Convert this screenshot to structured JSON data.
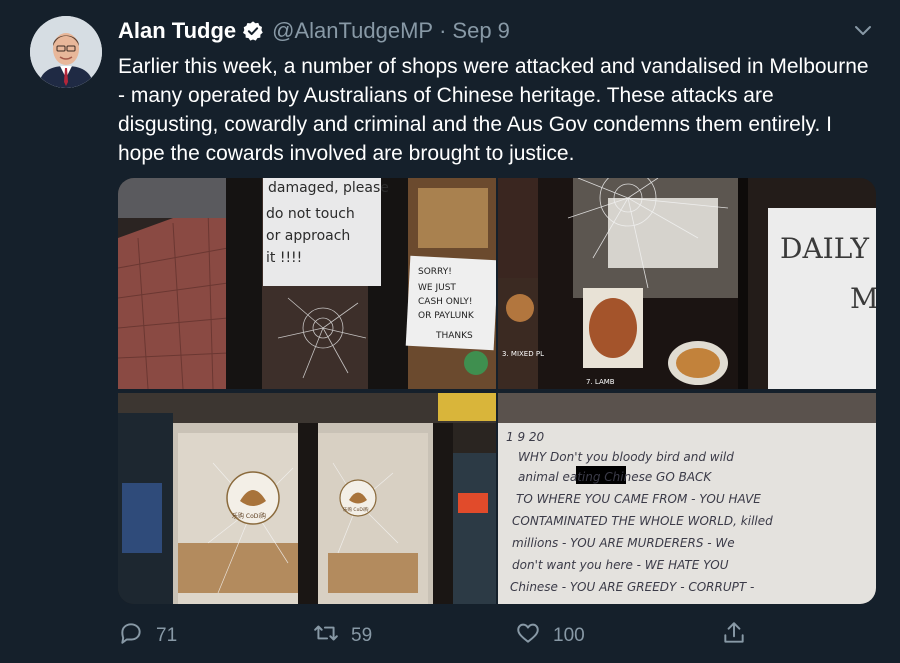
{
  "tweet": {
    "author_name": "Alan Tudge",
    "handle": "@AlanTudgeMP",
    "separator": "·",
    "date": "Sep 9",
    "text": "Earlier this week, a number of shops were attacked and vandalised in Melbourne - many operated by Australians of Chinese heritage. These attacks are disgusting, cowardly and criminal and the Aus Gov condemns them entirely. I hope the cowards involved are brought to justice."
  },
  "media": {
    "photo1": {
      "sign1": [
        "damaged, please",
        "do not touch",
        "or approach",
        "it !!!!"
      ],
      "sign2": [
        "SORRY!",
        "WE JUST",
        "CASH ONLY!",
        "OR PAYLUNK",
        "THANKS"
      ]
    },
    "photo2": {
      "sign": [
        "DAILY",
        "M"
      ],
      "menu_label_1": "3. MIXED PL",
      "menu_label_2": "7. LAMB"
    },
    "photo3": {
      "logo_text": "乐购 CoDi购"
    },
    "photo4": {
      "note_lines": [
        "1 9 20",
        "WHY Don't you bloody bird and wild",
        "animal             eating Chinese GO BACK",
        "TO WHERE YOU CAME FROM - YOU HAVE",
        "CONTAMINATED THE WHOLE WORLD, killed",
        "millions - YOU ARE MURDERERS - We",
        "don't want you here - WE HATE YOU",
        "Chinese - YOU ARE GREEDY - CORRUPT -"
      ]
    }
  },
  "actions": {
    "replies": "71",
    "retweets": "59",
    "likes": "100"
  },
  "colors": {
    "background": "#15202b",
    "secondary_text": "#8899a6",
    "verified_badge": "#ffffff"
  }
}
